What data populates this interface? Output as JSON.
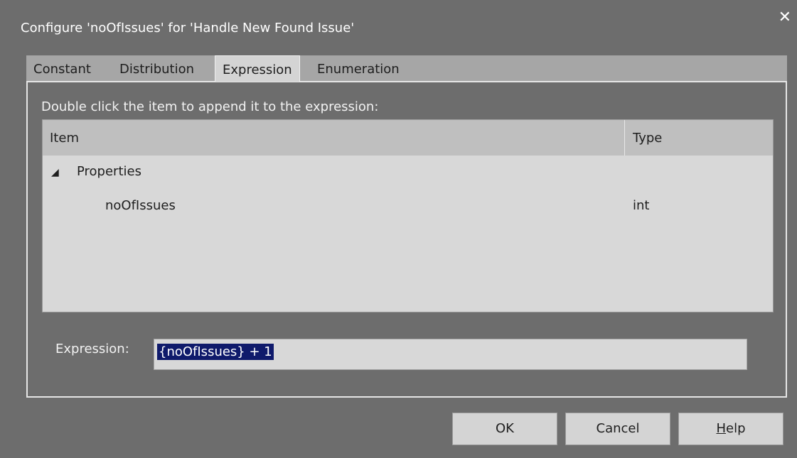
{
  "window": {
    "title": "Configure 'noOfIssues' for 'Handle New Found Issue'",
    "close_glyph": "✕"
  },
  "tabs": [
    {
      "label": "Constant",
      "active": false
    },
    {
      "label": "Distribution",
      "active": false
    },
    {
      "label": "Expression",
      "active": true
    },
    {
      "label": "Enumeration",
      "active": false
    }
  ],
  "panel": {
    "instruction": "Double click the item to append it to the expression:",
    "columns": {
      "item": "Item",
      "type": "Type"
    },
    "tree": {
      "toggle_glyph": "◢",
      "group": "Properties",
      "rows": [
        {
          "name": "noOfIssues",
          "type": "int"
        }
      ]
    },
    "expression": {
      "label": "Expression:",
      "value": "{noOfIssues} + 1"
    }
  },
  "buttons": {
    "ok": "OK",
    "cancel": "Cancel",
    "help_mnemonic": "H",
    "help_rest": "elp"
  },
  "colors": {
    "dialog_bg": "#6d6d6d",
    "selection": "#0f1a6b",
    "list_bg": "#d8d8d8"
  }
}
